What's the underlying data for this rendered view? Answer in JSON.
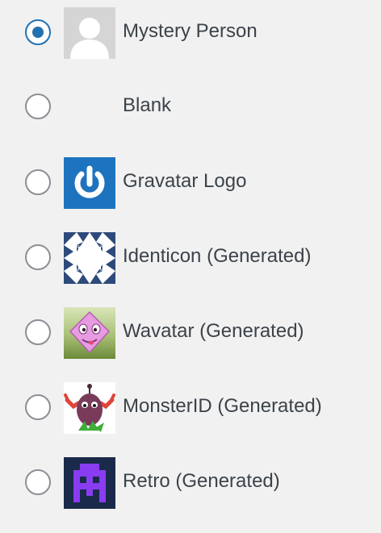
{
  "default_avatar": {
    "selected_index": 0,
    "options": [
      {
        "label": "Mystery Person",
        "icon": "mystery-person-icon",
        "checked": true
      },
      {
        "label": "Blank",
        "icon": "blank-avatar",
        "checked": false
      },
      {
        "label": "Gravatar Logo",
        "icon": "gravatar-logo-icon",
        "checked": false
      },
      {
        "label": "Identicon (Generated)",
        "icon": "identicon-icon",
        "checked": false
      },
      {
        "label": "Wavatar (Generated)",
        "icon": "wavatar-icon",
        "checked": false
      },
      {
        "label": "MonsterID (Generated)",
        "icon": "monsterid-icon",
        "checked": false
      },
      {
        "label": "Retro (Generated)",
        "icon": "retro-icon",
        "checked": false
      }
    ]
  },
  "colors": {
    "accent": "#2271b1",
    "background": "#f1f1f1",
    "text": "#3c434a",
    "radio_border": "#8c8f94"
  }
}
